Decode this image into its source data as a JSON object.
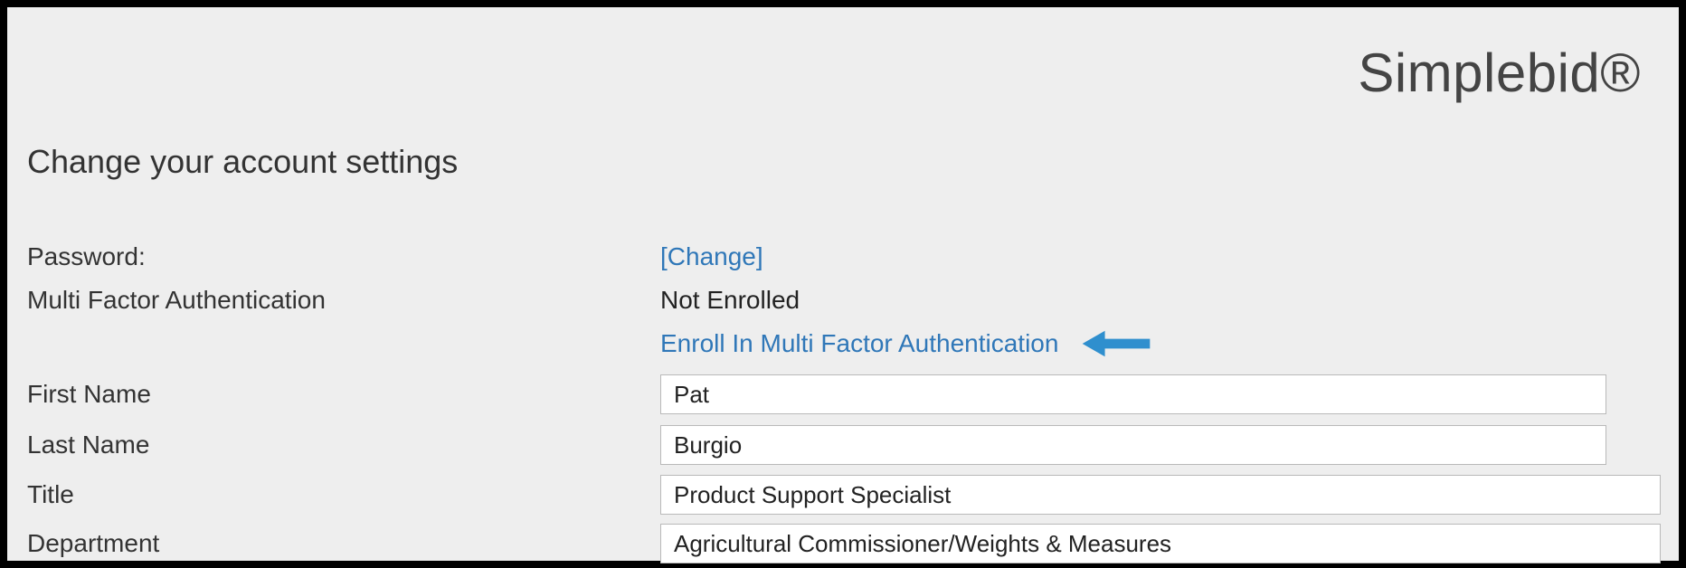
{
  "brand": "Simplebid®",
  "title": "Change your account settings",
  "link_color": "#2f77b8",
  "arrow_color": "#2f8fce",
  "fields": {
    "password": {
      "label": "Password:",
      "change_link": "[Change]"
    },
    "mfa": {
      "label": "Multi Factor Authentication",
      "status": "Not Enrolled",
      "enroll_link": "Enroll In Multi Factor Authentication"
    },
    "first_name": {
      "label": "First Name",
      "value": "Pat"
    },
    "last_name": {
      "label": "Last Name",
      "value": "Burgio"
    },
    "title": {
      "label": "Title",
      "value": "Product Support Specialist"
    },
    "department": {
      "label": "Department",
      "value": "Agricultural Commissioner/Weights & Measures"
    }
  }
}
